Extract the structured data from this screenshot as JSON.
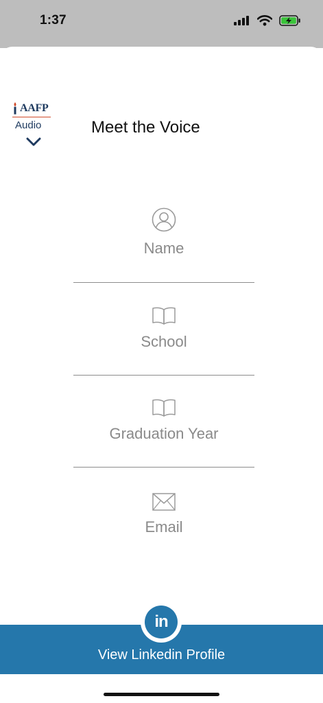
{
  "status": {
    "time": "1:37"
  },
  "header": {
    "logo_text": "AAFP",
    "logo_sub": "Audio",
    "title": "Meet the Voice"
  },
  "fields": {
    "name_label": "Name",
    "school_label": "School",
    "grad_label": "Graduation Year",
    "email_label": "Email"
  },
  "bottom": {
    "linkedin_glyph": "in",
    "label": "View Linkedin Profile"
  },
  "colors": {
    "accent": "#2577ab",
    "statusbar": "#bdbdbd",
    "label_gray": "#8a8a8a",
    "logo_navy": "#1e3a5f"
  }
}
